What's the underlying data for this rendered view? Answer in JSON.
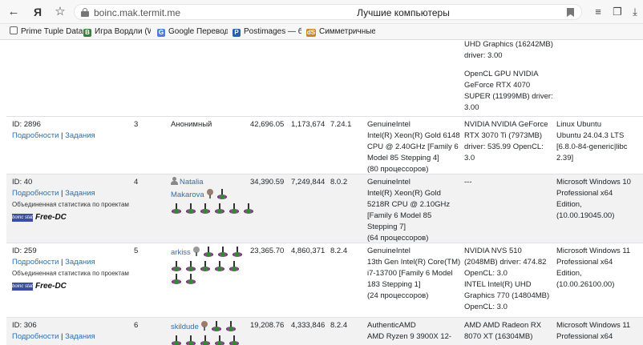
{
  "browser": {
    "url": "boinc.mak.termit.me",
    "title": "Лучшие компьютеры",
    "ya_glyph": "Я",
    "bookmarks": [
      {
        "label": "Prime Tuple Datab",
        "icon": "page"
      },
      {
        "label": "Игра Вордли (Wo",
        "icon": "B"
      },
      {
        "label": "Google Переводч",
        "icon": "G"
      },
      {
        "label": "Postimages — бес",
        "icon": "P"
      },
      {
        "label": "Симметричные ч",
        "icon": "dS"
      }
    ]
  },
  "top_cell": {
    "gpu_lines": [
      "UHD Graphics (16242MB)",
      "driver: 3.00",
      "",
      "OpenCL GPU NVIDIA",
      "GeForce RTX 4070",
      "SUPER (11999MB) driver:",
      "3.00"
    ]
  },
  "rows": [
    {
      "id": "ID: 2896",
      "details": "Подробности",
      "sep": "|",
      "tasks": "Задания",
      "rank": "3",
      "user": "Анонимный",
      "avg": "42,696.05",
      "total": "1,173,674",
      "version": "7.24.1",
      "cpu": [
        "GenuineIntel",
        "Intel(R) Xeon(R) Gold 6148",
        "CPU @ 2.40GHz [Family 6",
        "Model 85 Stepping 4]",
        "(80 процессоров)"
      ],
      "gpu": [
        "NVIDIA NVIDIA GeForce",
        "RTX 3070 Ti (7973MB)",
        "driver: 535.99 OpenCL:",
        "3.0"
      ],
      "os": [
        "Linux Ubuntu",
        "Ubuntu 24.04.3 LTS",
        "[6.8.0-84-generic|libc",
        "2.39]"
      ]
    },
    {
      "id": "ID: 40",
      "details": "Подробности",
      "sep": "|",
      "tasks": "Задания",
      "stats_note": "Объединенная статистика по проектам",
      "team_logo": "boinc stats",
      "team": "Free-DC",
      "rank": "4",
      "user_line1": "Natalia",
      "user_line2": "Makarova",
      "avg": "34,390.59",
      "total": "7,249,844",
      "version": "8.0.2",
      "cpu": [
        "GenuineIntel",
        "Intel(R) Xeon(R) Gold",
        "5218R CPU @ 2.10GHz",
        "[Family 6 Model 85",
        "Stepping 7]",
        "(64 процессоров)"
      ],
      "gpu": [
        "---"
      ],
      "os": [
        "Microsoft Windows 10",
        "Professional x64",
        "Edition,",
        "(10.00.19045.00)"
      ]
    },
    {
      "id": "ID: 259",
      "details": "Подробности",
      "sep": "|",
      "tasks": "Задания",
      "stats_note": "Объединенная статистика по проектам",
      "team_logo": "boinc stats",
      "team": "Free-DC",
      "rank": "5",
      "user": "arkiss",
      "avg": "23,365.70",
      "total": "4,860,371",
      "version": "8.2.4",
      "cpu": [
        "GenuineIntel",
        "13th Gen Intel(R) Core(TM)",
        "i7-13700 [Family 6 Model",
        "183 Stepping 1]",
        "(24 процессоров)"
      ],
      "gpu": [
        "NVIDIA NVS 510",
        "(2048MB) driver: 474.82",
        "OpenCL: 3.0",
        "INTEL Intel(R) UHD",
        "Graphics 770 (14804MB)",
        "OpenCL: 3.0"
      ],
      "os": [
        "Microsoft Windows 11",
        "Professional x64",
        "Edition,",
        "(10.00.26100.00)"
      ]
    },
    {
      "id": "ID: 306",
      "details": "Подробности",
      "sep": "|",
      "tasks": "Задания",
      "rank": "6",
      "user": "skildude",
      "avg": "19,208.76",
      "total": "4,333,846",
      "version": "8.2.4",
      "cpu": [
        "AuthenticAMD",
        "AMD Ryzen 9 3900X 12-"
      ],
      "gpu": [
        "AMD AMD Radeon RX",
        "8070 XT (16304MB)"
      ],
      "os": [
        "Microsoft Windows 11",
        "Professional x64"
      ]
    }
  ]
}
